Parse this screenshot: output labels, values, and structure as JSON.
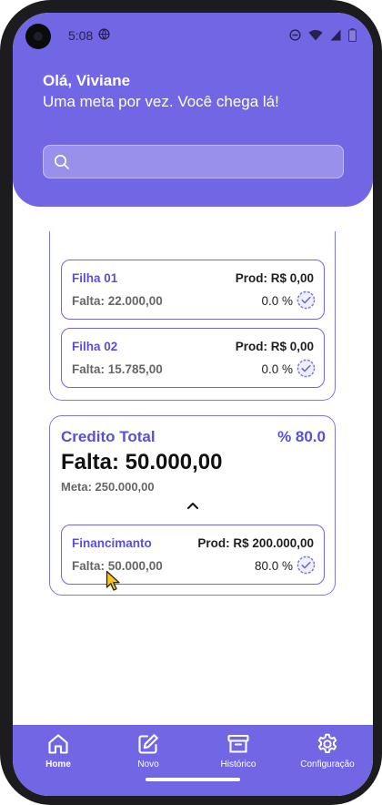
{
  "status": {
    "time": "5:08"
  },
  "header": {
    "greeting": "Olá, Viviane",
    "subtitle": "Uma meta por vez. Você chega lá!",
    "search_value": "",
    "search_placeholder": ""
  },
  "goals": [
    {
      "name": "Filha 01",
      "prod": "Prod: R$ 0,00",
      "falta": "Falta: 22.000,00",
      "percent": "0.0 %"
    },
    {
      "name": "Filha 02",
      "prod": "Prod: R$ 0,00",
      "falta": "Falta: 15.785,00",
      "percent": "0.0 %"
    }
  ],
  "credit_group": {
    "title": "Credito Total",
    "percent": "% 80.0",
    "falta": "Falta: 50.000,00",
    "meta": "Meta: 250.000,00",
    "items": [
      {
        "name": "Financimanto",
        "prod": "Prod: R$ 200.000,00",
        "falta": "Falta: 50.000,00",
        "percent": "80.0 %"
      }
    ]
  },
  "nav": [
    {
      "label": "Home",
      "icon": "home-icon",
      "active": true
    },
    {
      "label": "Novo",
      "icon": "edit-icon",
      "active": false
    },
    {
      "label": "Histórico",
      "icon": "archive-icon",
      "active": false
    },
    {
      "label": "Configuração",
      "icon": "gear-icon",
      "active": false
    }
  ],
  "colors": {
    "primary": "#7166e3",
    "accent_text": "#5a4fd6",
    "border": "#7f78df"
  }
}
